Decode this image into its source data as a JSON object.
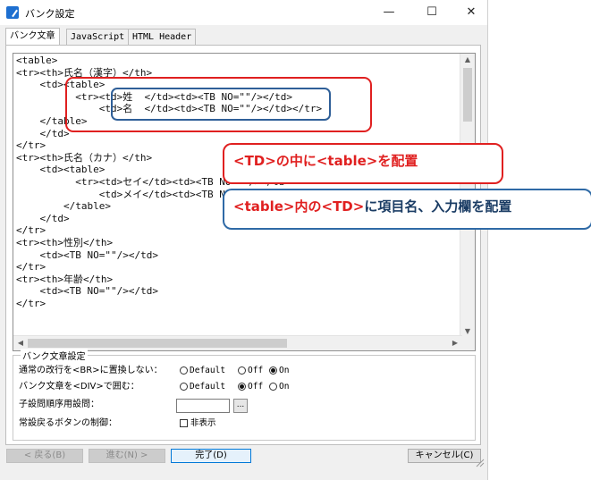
{
  "window": {
    "title": "バンク設定",
    "controls": {
      "minimize": "—",
      "maximize": "☐",
      "close": "✕"
    }
  },
  "tabs": [
    {
      "label": "バンク文章",
      "active": true
    },
    {
      "label": "JavaScript",
      "active": false
    },
    {
      "label": "HTML Header",
      "active": false
    }
  ],
  "editor": {
    "lines": [
      "<table>",
      "<tr><th>氏名（漢字）</th>",
      "    <td><table>",
      "          <tr><td>姓  </td><td><TB NO=\"\"/></td>",
      "              <td>名  </td><td><TB NO=\"\"/></td></tr>",
      "    </table>",
      "    </td>",
      "</tr>",
      "<tr><th>氏名（カナ）</th>",
      "    <td><table>",
      "          <tr><td>セイ</td><td><TB NO=\"\"/></td>",
      "              <td>メイ</td><td><TB NO=\"\"/></td>",
      "        </table>",
      "    </td>",
      "</tr>",
      "<tr><th>性別</th>",
      "    <td><TB NO=\"\"/></td>",
      "</tr>",
      "<tr><th>年齢</th>",
      "    <td><TB NO=\"\"/></td>",
      "</tr>"
    ]
  },
  "callouts": {
    "red": {
      "part1": "<TD>",
      "part2": "の中に",
      "part3": "<table>",
      "part4": "を配置"
    },
    "blue": {
      "part1": "<table>",
      "part2": "内の",
      "part3": "<TD>",
      "part4": "に項目名、入力欄を配置"
    }
  },
  "settings": {
    "legend": "バンク文章設定",
    "row1": {
      "label": "通常の改行を<BR>に置換しない：",
      "options": [
        "Default",
        "Off",
        "On"
      ],
      "selected": "On"
    },
    "row2": {
      "label": "バンク文章を<DIV>で囲む：",
      "options": [
        "Default",
        "Off",
        "On"
      ],
      "selected": "Off"
    },
    "row3": {
      "label": "子設問順序用設問：",
      "value": "",
      "button": "..."
    },
    "row4": {
      "label": "常設戻るボタンの制御：",
      "checkbox_label": "非表示",
      "checked": false
    }
  },
  "buttons": {
    "back": "< 戻る(B)",
    "next": "進む(N) >",
    "done": "完了(D)",
    "cancel": "キャンセル(C)"
  },
  "colors": {
    "red": "#e02020",
    "blue": "#2f6aa6",
    "accent": "#0078d7"
  }
}
